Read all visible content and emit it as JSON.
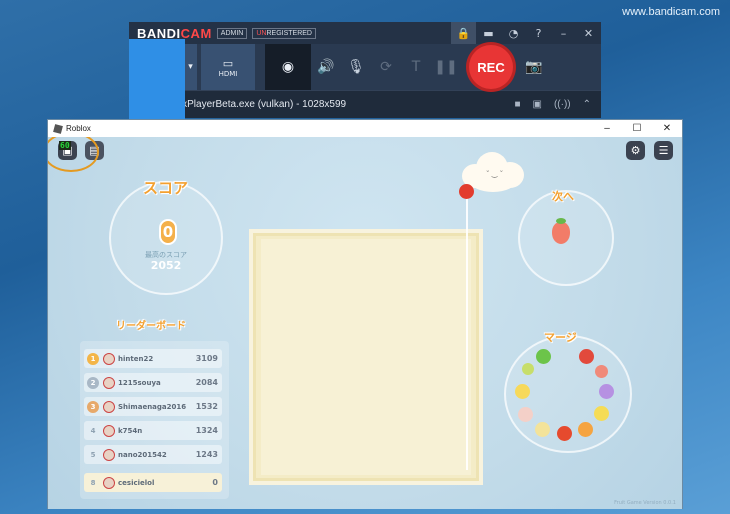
{
  "watermark": "www.bandicam.com",
  "bandicam": {
    "logo_main": "BANDI",
    "logo_accent": "CAM",
    "badge_admin": "ADMIN",
    "badge_unreg_prefix": "UN",
    "badge_unreg_rest": "REGISTERED",
    "title_icons": [
      "lock-icon",
      "folder-icon",
      "clock-icon",
      "help-icon",
      "minimize-icon",
      "close-icon"
    ],
    "tools": {
      "hdmi_label": "HDMI",
      "rec_label": "REC"
    },
    "target": {
      "text": "RobloxPlayerBeta.exe (vulkan) - 1028x599"
    }
  },
  "roblox": {
    "window_title": "Roblox",
    "fps": "60",
    "score": {
      "title": "スコア",
      "value": "0",
      "best_label": "最高のスコア",
      "best_value": "2052"
    },
    "next": {
      "title": "次へ"
    },
    "merge": {
      "title": "マージ"
    },
    "leaderboard": {
      "title": "リーダーボード",
      "rows": [
        {
          "rank": "1",
          "name": "hinten22",
          "score": "3109",
          "color": "#f3b548"
        },
        {
          "rank": "2",
          "name": "1215souya",
          "score": "2084",
          "color": "#a9b8c6"
        },
        {
          "rank": "3",
          "name": "Shimaenaga2016",
          "score": "1532",
          "color": "#e7a96a"
        },
        {
          "rank": "4",
          "name": "k754n",
          "score": "1324",
          "color": ""
        },
        {
          "rank": "5",
          "name": "nano201542",
          "score": "1243",
          "color": ""
        }
      ],
      "me": {
        "rank": "8",
        "name": "cesicielol",
        "score": "0"
      }
    },
    "version": "Fruit Game Version 0.0.1",
    "colors": {
      "accent_orange": "#f3a02f",
      "rec_red": "#e83535",
      "bandicam_blue": "#2f8fe6"
    }
  }
}
